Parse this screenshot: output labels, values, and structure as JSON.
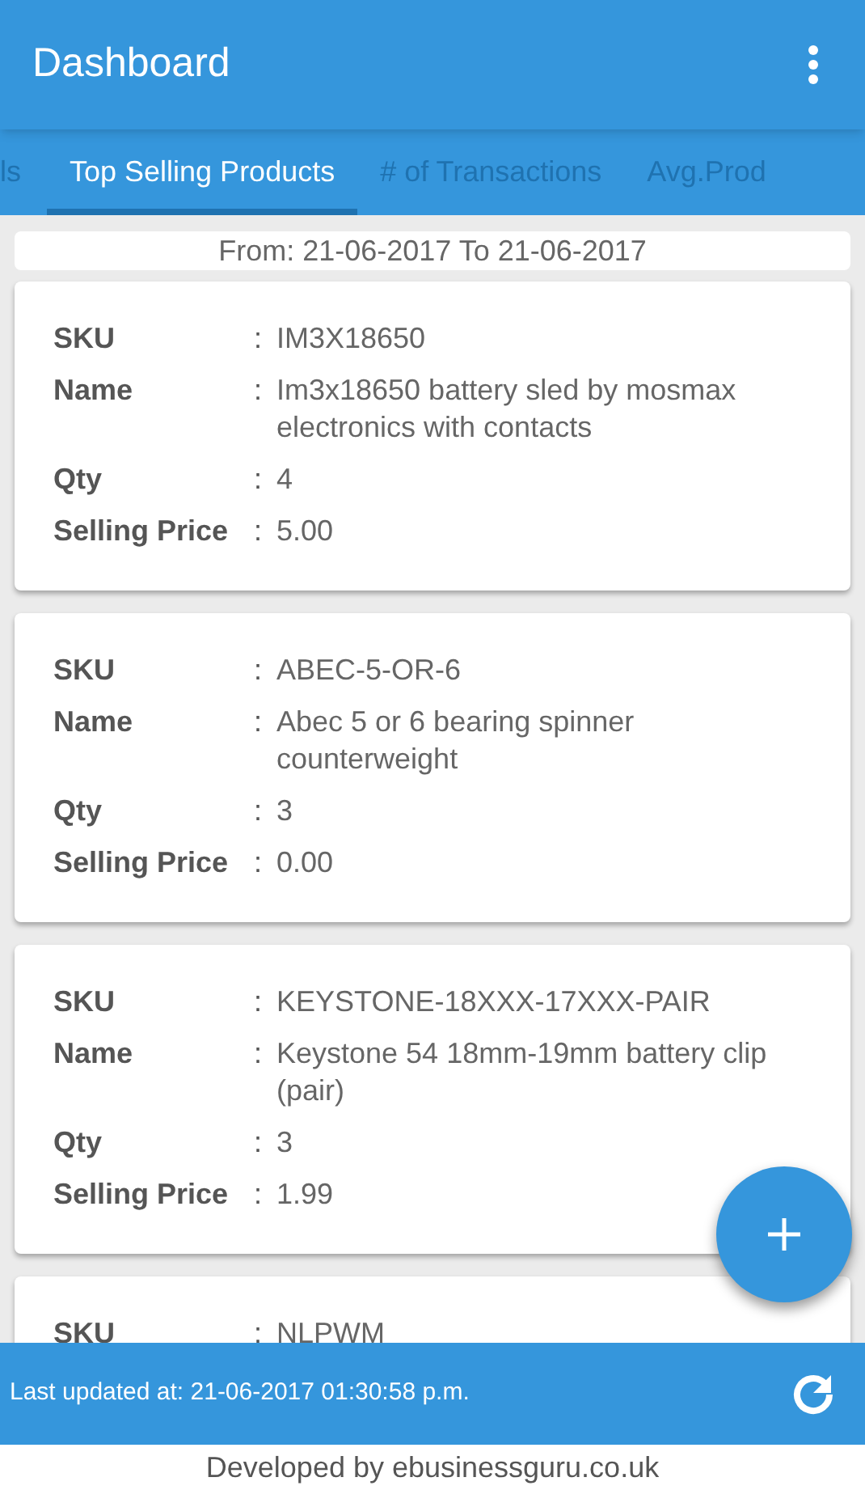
{
  "app_bar": {
    "title": "Dashboard"
  },
  "tabs": [
    {
      "label": "ls",
      "selected": false
    },
    {
      "label": "Top Selling Products",
      "selected": true
    },
    {
      "label": "# of Transactions",
      "selected": false
    },
    {
      "label": "Avg.Prod",
      "selected": false
    }
  ],
  "date_range": "From: 21-06-2017 To 21-06-2017",
  "products": [
    {
      "fields": [
        {
          "label": "SKU",
          "separator": ":",
          "value": "IM3X18650"
        },
        {
          "label": "Name",
          "separator": ":",
          "value": "Im3x18650 battery sled by mosmax electronics with contacts"
        },
        {
          "label": "Qty",
          "separator": ":",
          "value": "4"
        },
        {
          "label": "Selling Price",
          "separator": ":",
          "value": "5.00"
        }
      ]
    },
    {
      "fields": [
        {
          "label": "SKU",
          "separator": ":",
          "value": "ABEC-5-OR-6"
        },
        {
          "label": "Name",
          "separator": ":",
          "value": "Abec 5 or 6 bearing spinner counterweight"
        },
        {
          "label": "Qty",
          "separator": ":",
          "value": "3"
        },
        {
          "label": "Selling Price",
          "separator": ":",
          "value": "0.00"
        }
      ]
    },
    {
      "fields": [
        {
          "label": "SKU",
          "separator": ":",
          "value": "KEYSTONE-18XXX-17XXX-PAIR"
        },
        {
          "label": "Name",
          "separator": ":",
          "value": "Keystone 54 18mm-19mm battery clip (pair)"
        },
        {
          "label": "Qty",
          "separator": ":",
          "value": "3"
        },
        {
          "label": "Selling Price",
          "separator": ":",
          "value": "1.99"
        }
      ]
    },
    {
      "fields": [
        {
          "label": "SKU",
          "separator": ":",
          "value": "NLPWM"
        }
      ]
    }
  ],
  "status_bar": {
    "text": "Last updated at: 21-06-2017 01:30:58 p.m."
  },
  "footer": "Developed by ebusinessguru.co.uk"
}
